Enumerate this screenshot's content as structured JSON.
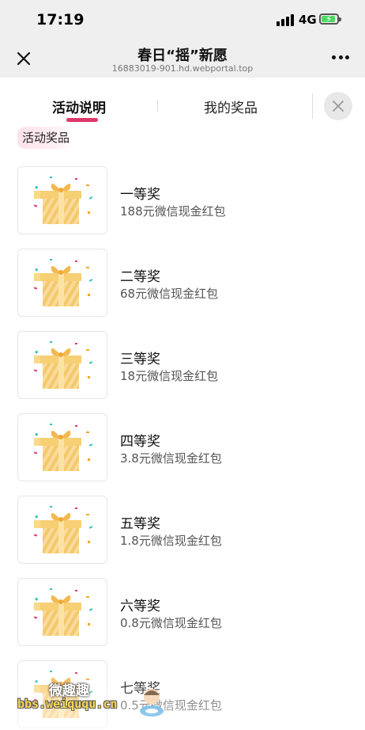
{
  "status_bar": {
    "time": "17:19",
    "network": "4G"
  },
  "nav": {
    "title": "春日“摇”新愿",
    "url": "16883019-901.hd.webportal.top"
  },
  "tabs": [
    {
      "label": "活动说明"
    },
    {
      "label": "我的奖品"
    }
  ],
  "section": {
    "label": "活动奖品"
  },
  "prizes": [
    {
      "name": "一等奖",
      "desc": "188元微信现金红包"
    },
    {
      "name": "二等奖",
      "desc": "68元微信现金红包"
    },
    {
      "name": "三等奖",
      "desc": "18元微信现金红包"
    },
    {
      "name": "四等奖",
      "desc": "3.8元微信现金红包"
    },
    {
      "name": "五等奖",
      "desc": "1.8元微信现金红包"
    },
    {
      "name": "六等奖",
      "desc": "0.8元微信现金红包"
    },
    {
      "name": "七等奖",
      "desc": "0.5元微信现金红包"
    }
  ],
  "watermark": {
    "title": "微趣趣",
    "url": "bbs.weiququ.cn"
  },
  "colors": {
    "accent": "#e0386c",
    "battery": "#4cd964",
    "gift": "#f5c86a"
  }
}
